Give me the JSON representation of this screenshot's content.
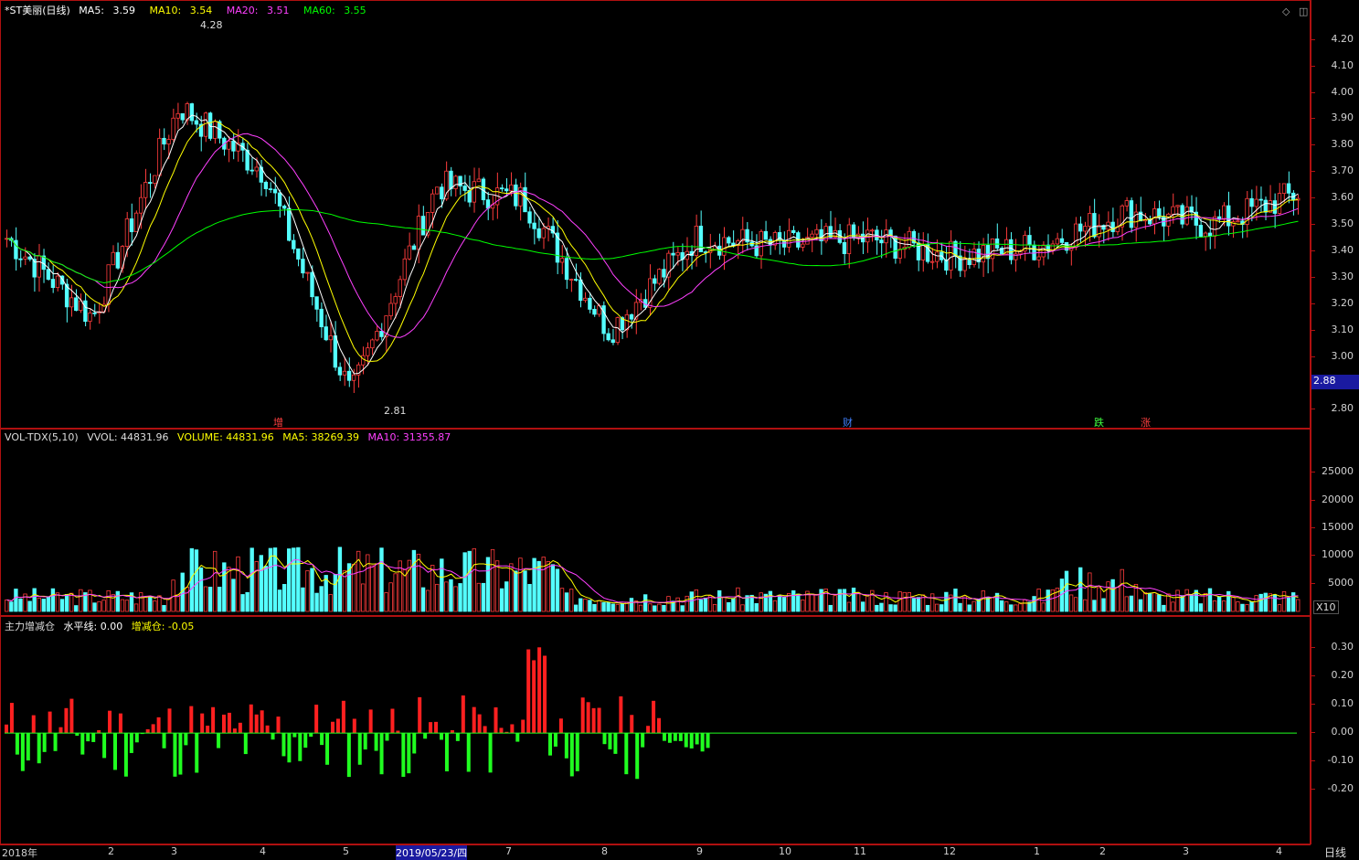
{
  "price": {
    "name": "*ST美丽(日线)",
    "ma": [
      {
        "label": "MA5:",
        "value": "3.59",
        "color": "#ffffff"
      },
      {
        "label": "MA10:",
        "value": "3.54",
        "color": "#ffff00"
      },
      {
        "label": "MA20:",
        "value": "3.51",
        "color": "#ff40ff"
      },
      {
        "label": "MA60:",
        "value": "3.55",
        "color": "#00ff00"
      }
    ],
    "ticks": [
      "4.20",
      "4.10",
      "4.00",
      "3.90",
      "3.80",
      "3.70",
      "3.60",
      "3.50",
      "3.40",
      "3.30",
      "3.20",
      "3.10",
      "3.00",
      "2.80"
    ],
    "tick_values": [
      4.2,
      4.1,
      4.0,
      3.9,
      3.8,
      3.7,
      3.6,
      3.5,
      3.4,
      3.3,
      3.2,
      3.1,
      3.0,
      2.8
    ],
    "current_label": "2.88",
    "high_label": "4.28",
    "low_label": "2.81",
    "events": [
      {
        "text": "增",
        "color": "#ff4040"
      },
      {
        "text": "财",
        "color": "#4080ff"
      },
      {
        "text": "跌",
        "color": "#40ff40"
      },
      {
        "text": "涨",
        "color": "#ff4040"
      }
    ],
    "ylim": [
      2.76,
      4.32
    ]
  },
  "volume": {
    "name": "VOL-TDX(5,10)",
    "vvol_label": "VVOL: 44831.96",
    "items": [
      {
        "text": "VOLUME: 44831.96",
        "color": "#ffff00"
      },
      {
        "text": "MA5: 38269.39",
        "color": "#ffff00"
      },
      {
        "text": "MA10: 31355.87",
        "color": "#ff40ff"
      }
    ],
    "ticks": [
      "25000",
      "20000",
      "15000",
      "10000",
      "5000"
    ],
    "tick_values": [
      25000,
      20000,
      15000,
      10000,
      5000
    ],
    "unit": "X10",
    "ymax": 29500
  },
  "indicator": {
    "name": "主力增减仓",
    "items": [
      {
        "text": "水平线: 0.00",
        "color": "#ffffff"
      },
      {
        "text": "增减仓: -0.05",
        "color": "#ffff00"
      }
    ],
    "ticks": [
      "0.30",
      "0.20",
      "0.10",
      "0.00",
      "-0.10",
      "-0.20"
    ],
    "tick_values": [
      0.3,
      0.2,
      0.1,
      0.0,
      -0.1,
      -0.2
    ],
    "ylim": [
      -0.37,
      0.39
    ]
  },
  "xaxis": {
    "labels": [
      "2018年",
      "2",
      "3",
      "4",
      "5",
      "2019/05/23/四",
      "7",
      "8",
      "9",
      "10",
      "11",
      "12",
      "1",
      "2",
      "3",
      "4"
    ],
    "period": "日线"
  },
  "chart_data": {
    "type": "line",
    "title": "*ST美丽(日线)",
    "series": [
      {
        "name": "MA5",
        "values": [
          3.59
        ]
      },
      {
        "name": "MA10",
        "values": [
          3.54
        ]
      },
      {
        "name": "MA20",
        "values": [
          3.51
        ]
      },
      {
        "name": "MA60",
        "values": [
          3.55
        ]
      }
    ],
    "price_anchors": [
      {
        "x": "2018年",
        "y": 3.45
      },
      {
        "x": "2",
        "y": 3.15
      },
      {
        "x": "3",
        "y": 3.95
      },
      {
        "x": "4",
        "y": 3.7
      },
      {
        "x": "5",
        "y": 2.85
      },
      {
        "x": "2019/05/23/四",
        "y": 3.65
      },
      {
        "x": "7",
        "y": 3.6
      },
      {
        "x": "8",
        "y": 3.1
      },
      {
        "x": "9",
        "y": 3.45
      },
      {
        "x": "10",
        "y": 3.42
      },
      {
        "x": "11",
        "y": 3.45
      },
      {
        "x": "12",
        "y": 3.38
      },
      {
        "x": "1",
        "y": 3.42
      },
      {
        "x": "2",
        "y": 3.55
      },
      {
        "x": "3",
        "y": 3.5
      },
      {
        "x": "4",
        "y": 3.62
      }
    ],
    "high": 4.28,
    "low": 2.81,
    "current": 2.88
  }
}
